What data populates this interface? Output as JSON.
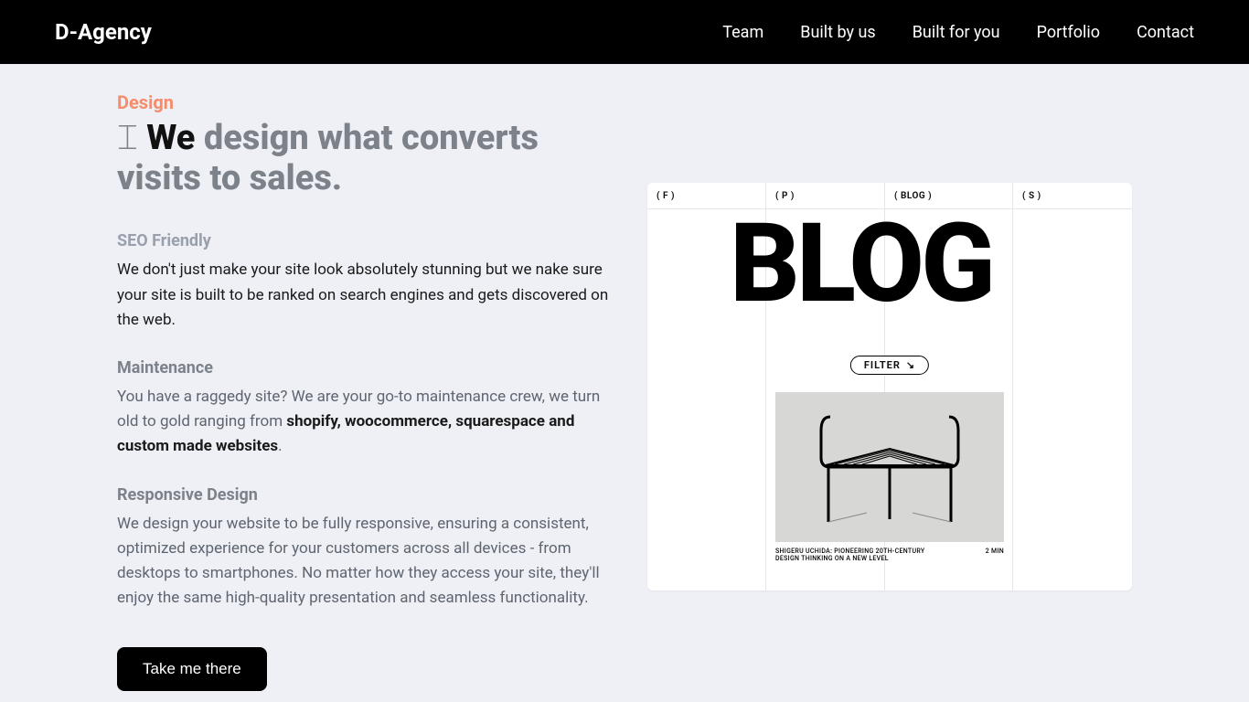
{
  "brand": "D-Agency",
  "nav": {
    "team": "Team",
    "built_by_us": "Built by us",
    "built_for_you": "Built for you",
    "portfolio": "Portfolio",
    "contact": "Contact"
  },
  "hero": {
    "eyebrow": "Design",
    "typed_word": "We",
    "headline_rest": " design what converts visits to sales."
  },
  "sections": {
    "seo": {
      "title": "SEO Friendly",
      "body": "We don't just make your site look absolutely stunning but we nake sure your site is built to be ranked on search engines and gets discovered on the web."
    },
    "maintenance": {
      "title": "Maintenance",
      "body_pre": "You have a raggedy site? We are your go-to maintenance crew, we turn old to gold ranging from ",
      "body_strong": "shopify, woocommerce, squarespace and custom made websites",
      "body_post": "."
    },
    "responsive": {
      "title": "Responsive Design",
      "body": "We design your website to be fully responsive, ensuring a consistent, optimized experience for your customers across all devices - from desktops to smartphones. No matter how they access your site, they'll enjoy the same high-quality presentation and seamless functionality."
    }
  },
  "cta_label": "Take me there",
  "slide": {
    "tab_f": "( F )",
    "tab_p": "( P )",
    "tab_blog": "( BLOG )",
    "tab_s": "( S )",
    "big_word": "BLOG",
    "filter_label": "FILTER",
    "card_title": "SHIGERU UCHIDA: PIONEERING 20TH-CENTURY DESIGN THINKING ON A NEW LEVEL",
    "card_time": "2 MIN"
  }
}
